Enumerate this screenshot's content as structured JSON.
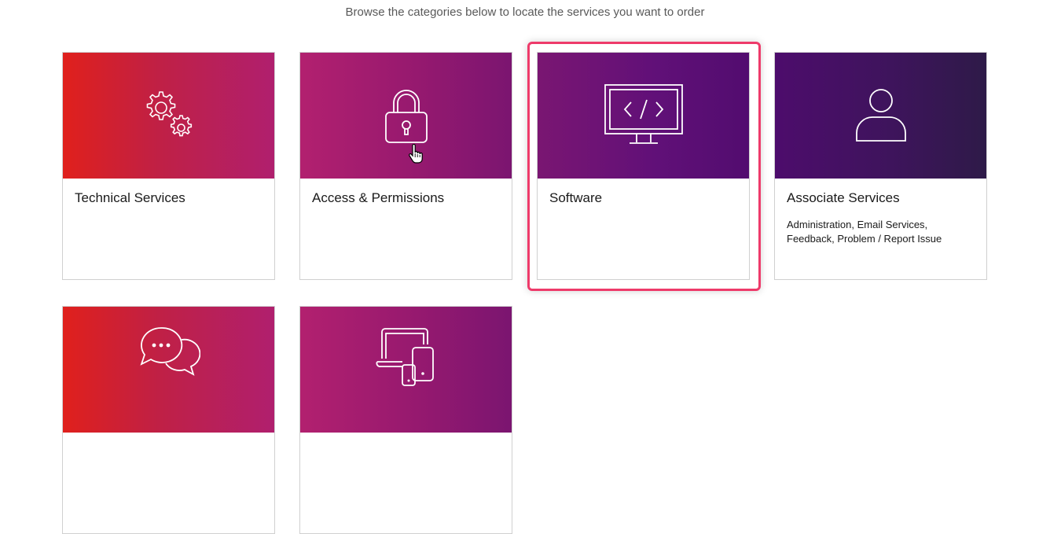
{
  "page": {
    "subtitle": "Browse the categories below to locate the services you want to order"
  },
  "categories": [
    {
      "title": "Technical Services",
      "description": "",
      "icon": "gears-icon"
    },
    {
      "title": "Access & Permissions",
      "description": "",
      "icon": "padlock-icon"
    },
    {
      "title": "Software",
      "description": "",
      "icon": "code-monitor-icon",
      "highlighted": true
    },
    {
      "title": "Associate Services",
      "description": "Administration, Email Services, Feedback, Problem / Report Issue",
      "icon": "person-icon"
    },
    {
      "title": "",
      "description": "",
      "icon": "chat-bubbles-icon"
    },
    {
      "title": "",
      "description": "",
      "icon": "devices-icon"
    }
  ],
  "colors": {
    "highlight_border": "#ee3a6a",
    "gradient_red": "#e0201c",
    "gradient_magenta": "#b2206f",
    "gradient_purple": "#520c6f",
    "gradient_dark": "#2e1a48"
  }
}
